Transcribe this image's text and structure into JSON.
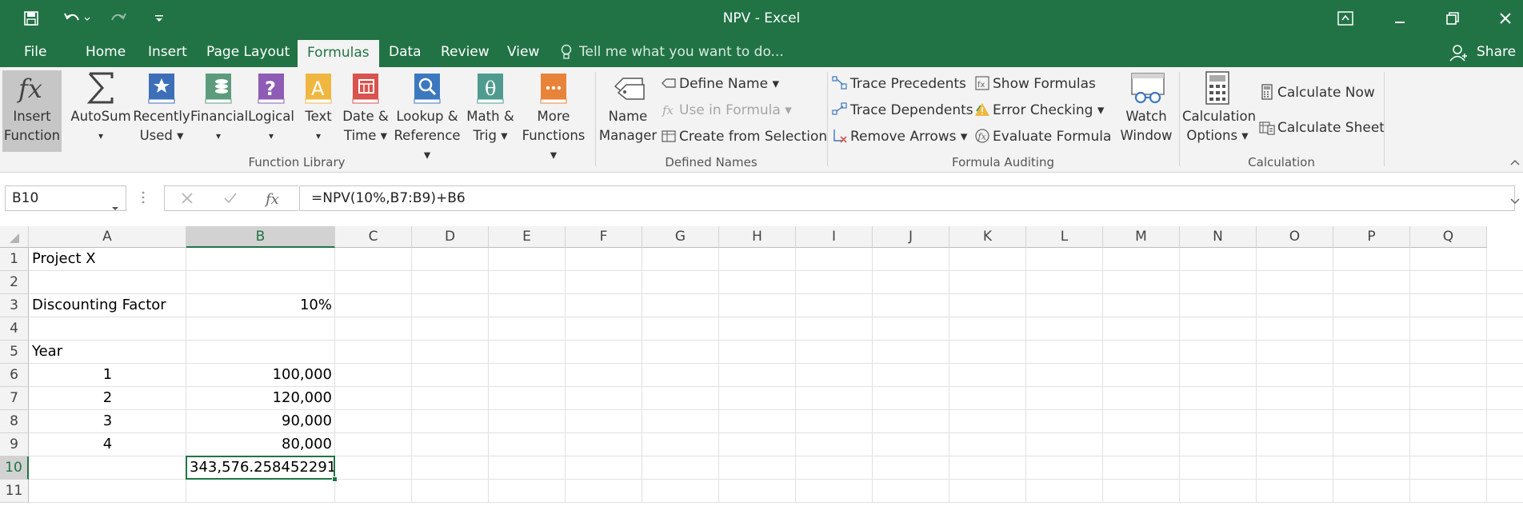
{
  "title": "NPV - Excel",
  "menu": {
    "tabs": [
      {
        "label": "File"
      },
      {
        "label": "Home"
      },
      {
        "label": "Insert"
      },
      {
        "label": "Page Layout"
      },
      {
        "label": "Formulas"
      },
      {
        "label": "Data"
      },
      {
        "label": "Review"
      },
      {
        "label": "View"
      }
    ],
    "tell_me": "Tell me what you want to do...",
    "share": "Share"
  },
  "ribbon": {
    "function_library": {
      "label": "Function Library",
      "insert_function": [
        "Insert",
        "Function"
      ],
      "autosum": [
        "AutoSum",
        "▾"
      ],
      "recently_used": [
        "Recently",
        "Used ▾"
      ],
      "financial": [
        "Financial",
        "▾"
      ],
      "logical": [
        "Logical",
        "▾"
      ],
      "text": [
        "Text",
        "▾"
      ],
      "date_time": [
        "Date &",
        "Time ▾"
      ],
      "lookup": [
        "Lookup &",
        "Reference ▾"
      ],
      "math": [
        "Math &",
        "Trig ▾"
      ],
      "more": [
        "More",
        "Functions ▾"
      ]
    },
    "defined_names": {
      "label": "Defined Names",
      "name_manager": [
        "Name",
        "Manager"
      ],
      "define_name": "Define Name ▾",
      "use_in_formula": "Use in Formula ▾",
      "create_from_selection": "Create from Selection"
    },
    "formula_auditing": {
      "label": "Formula Auditing",
      "trace_precedents": "Trace Precedents",
      "trace_dependents": "Trace Dependents",
      "remove_arrows": "Remove Arrows ▾",
      "show_formulas": "Show Formulas",
      "error_checking": "Error Checking ▾",
      "evaluate_formula": "Evaluate Formula",
      "watch_window": [
        "Watch",
        "Window"
      ]
    },
    "calculation": {
      "label": "Calculation",
      "options": [
        "Calculation",
        "Options ▾"
      ],
      "calc_now": "Calculate Now",
      "calc_sheet": "Calculate Sheet"
    }
  },
  "formula_bar": {
    "name_box": "B10",
    "formula": "=NPV(10%,B7:B9)+B6"
  },
  "sheet": {
    "columns": [
      "A",
      "B",
      "C",
      "D",
      "E",
      "F",
      "G",
      "H",
      "I",
      "J",
      "K",
      "L",
      "M",
      "N",
      "O",
      "P",
      "Q"
    ],
    "rows": [
      "1",
      "2",
      "3",
      "4",
      "5",
      "6",
      "7",
      "8",
      "9",
      "10",
      "11"
    ],
    "cells": {
      "A1": "Project X",
      "A3": "Discounting Factor",
      "B3": "10%",
      "A5": "Year",
      "A6": "1",
      "B6": "100,000",
      "A7": "2",
      "B7": "120,000",
      "A8": "3",
      "B8": "90,000",
      "A9": "4",
      "B9": "80,000",
      "B10": "343,576.258452291"
    },
    "selected_cell": "B10"
  },
  "colors": {
    "brand": "#217346",
    "ribbon_bg": "#f3f3f3"
  }
}
